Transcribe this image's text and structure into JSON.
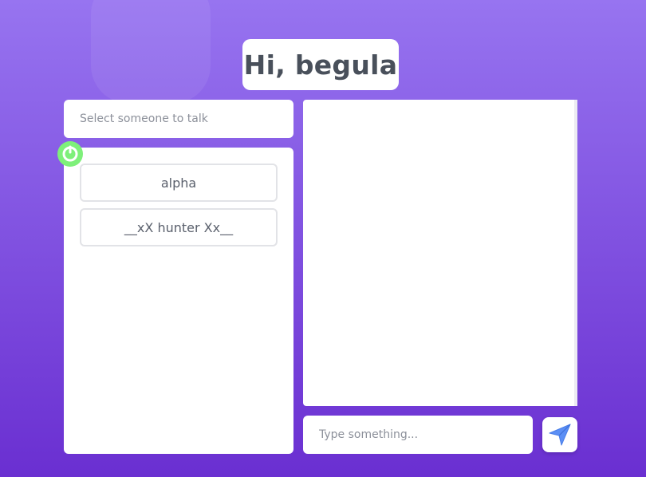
{
  "header": {
    "greeting": "Hi, begula"
  },
  "contacts": {
    "placeholder_text": "Select someone to talk",
    "users": [
      {
        "name": "alpha"
      },
      {
        "name": "__xX hunter Xx__"
      }
    ]
  },
  "composer": {
    "placeholder": "Type something..."
  },
  "icons": {
    "power": "power-icon",
    "send": "send-icon"
  },
  "colors": {
    "background_top": "#9774f0",
    "background_bottom": "#6a2fd1",
    "online_green": "#7ef07a",
    "send_blue": "#5b8ff5"
  }
}
